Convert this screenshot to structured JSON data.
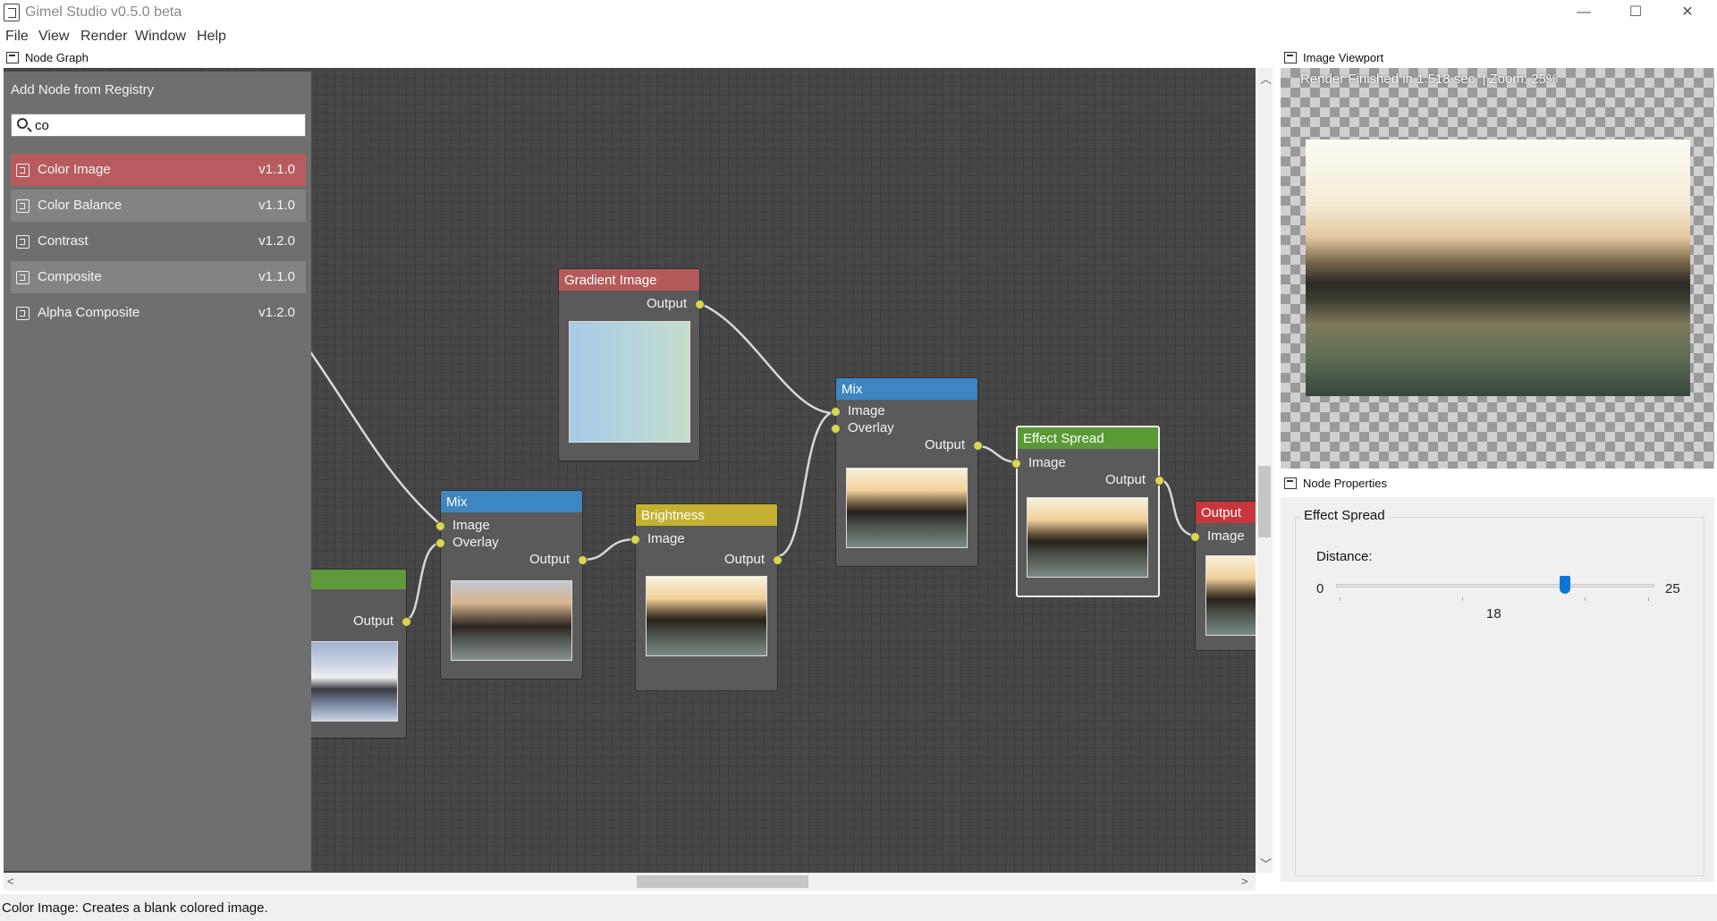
{
  "window": {
    "title": "Gimel Studio v0.5.0 beta",
    "controls": {
      "minimize": "—",
      "maximize": "☐",
      "close": "✕"
    }
  },
  "menu": [
    "File",
    "View",
    "Render",
    "Window",
    "Help"
  ],
  "node_graph": {
    "panel_title": "Node Graph",
    "registry": {
      "title": "Add Node from Registry",
      "search_value": "co",
      "items": [
        {
          "name": "Color Image",
          "version": "v1.1.0",
          "state": "selected"
        },
        {
          "name": "Color Balance",
          "version": "v1.1.0",
          "state": "alt"
        },
        {
          "name": "Contrast",
          "version": "v1.2.0",
          "state": "normal"
        },
        {
          "name": "Composite",
          "version": "v1.1.0",
          "state": "alt"
        },
        {
          "name": "Alpha Composite",
          "version": "v1.2.0",
          "state": "normal"
        }
      ]
    },
    "nodes": {
      "partial_image": {
        "output": "Output",
        "color": "#5e9a3c"
      },
      "gradient_image": {
        "title": "Gradient Image",
        "output": "Output",
        "color": "#b55a5a"
      },
      "mix_1": {
        "title": "Mix",
        "input1": "Image",
        "input2": "Overlay",
        "output": "Output",
        "color": "#3d86c2"
      },
      "brightness": {
        "title": "Brightness",
        "input1": "Image",
        "output": "Output",
        "color": "#c4b132"
      },
      "mix_2": {
        "title": "Mix",
        "input1": "Image",
        "input2": "Overlay",
        "output": "Output",
        "color": "#3d86c2"
      },
      "effect_spread": {
        "title": "Effect Spread",
        "input1": "Image",
        "output": "Output",
        "color": "#5a9a35"
      },
      "output": {
        "title": "Output",
        "input1": "Image",
        "color": "#c8363c"
      }
    }
  },
  "viewport": {
    "panel_title": "Image Viewport",
    "status": "Render Finished in 1.518 sec. | Zoom: 25%"
  },
  "properties": {
    "panel_title": "Node Properties",
    "group_title": "Effect Spread",
    "slider_label": "Distance:",
    "slider_min": "0",
    "slider_max": "25",
    "slider_value": "18",
    "slider_fraction": 0.72
  },
  "statusbar": {
    "text": "Color Image: Creates a blank colored image."
  }
}
